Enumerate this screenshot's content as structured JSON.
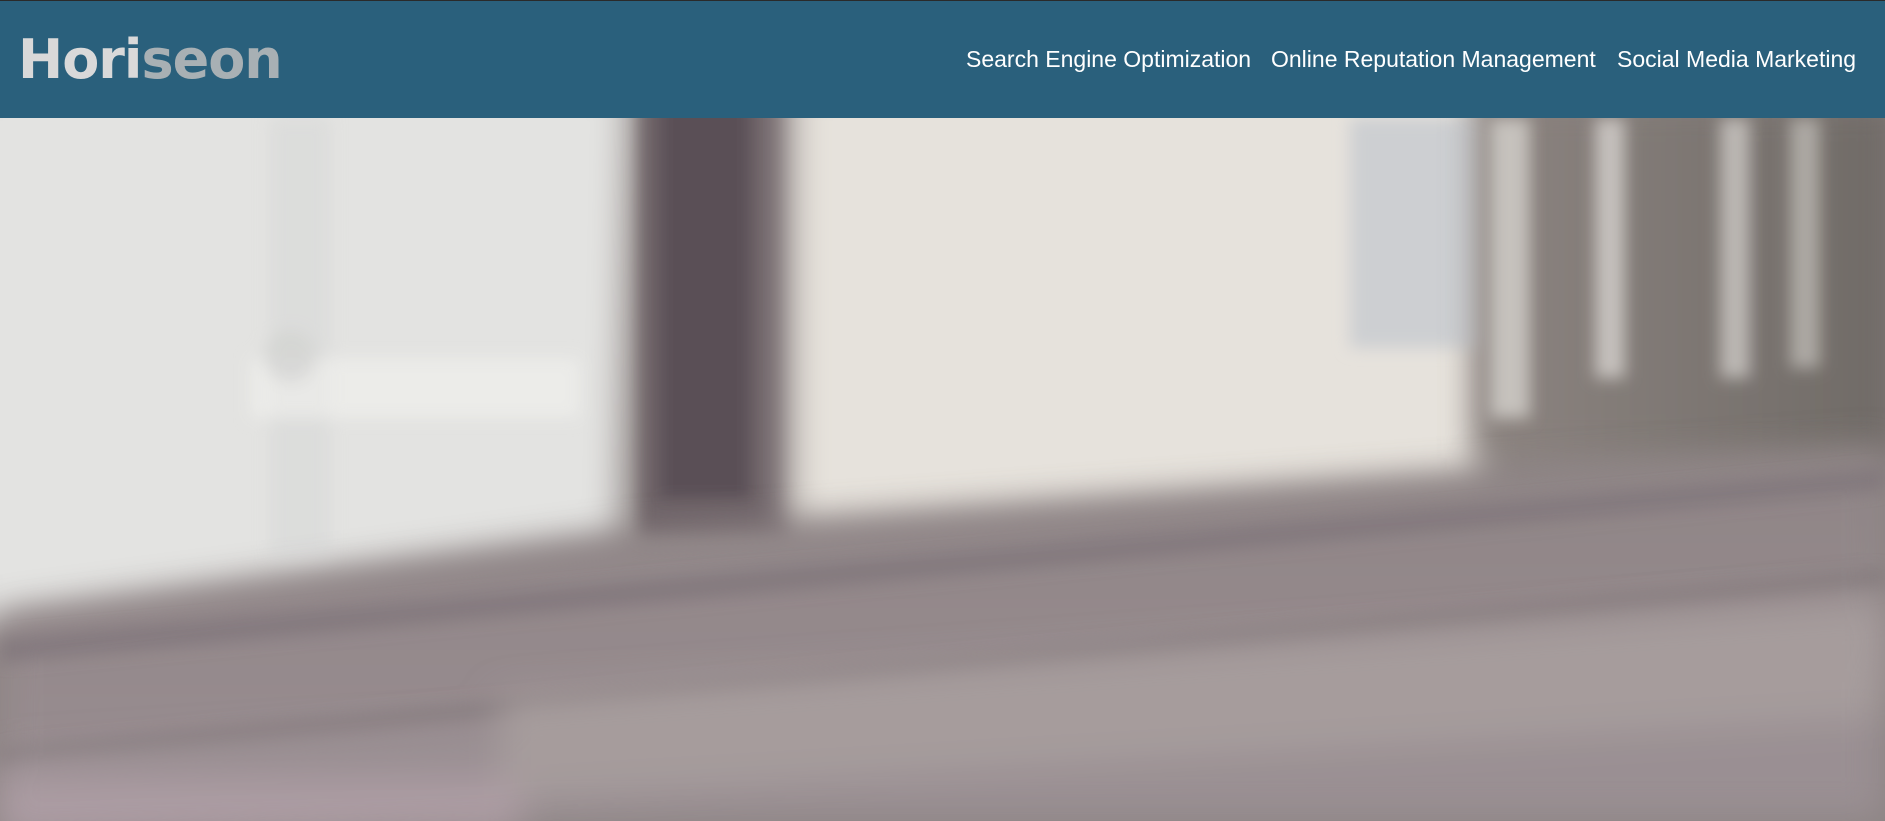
{
  "brand": {
    "logo_part_1": "Hori",
    "logo_part_2": "seon"
  },
  "nav": {
    "items": [
      {
        "label": "Search Engine Optimization"
      },
      {
        "label": "Online Reputation Management"
      },
      {
        "label": "Social Media Marketing"
      }
    ]
  },
  "colors": {
    "header_bg": "#2a607c",
    "logo_light": "#d9d9d9",
    "logo_grey": "#a8b0b4",
    "nav_text": "#ffffff"
  }
}
